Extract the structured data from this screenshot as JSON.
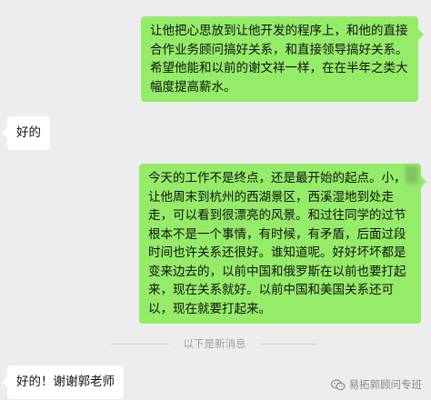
{
  "messages": [
    {
      "side": "out",
      "text": "让他把心思放到让他开发的程序上，和他的直接合作业务顾问搞好关系，和直接领导搞好关系。希望他能和以前的谢文祥一样，在在半年之类大幅度提高薪水。"
    },
    {
      "side": "in",
      "text": "好的"
    },
    {
      "side": "out",
      "text": "今天的工作不是终点，还是最开始的起点。小，让他周末到杭州的西湖景区，西溪湿地到处走走，可以看到很漂亮的风景。和过往同学的过节根本不是一个事情，有时候，有矛盾，后面过段时间也许关系还很好。谁知道呢。好好坏坏都是变来边去的，以前中国和俄罗斯在以前也要打起来，现在关系就好。以前中国和美国关系还可以，现在就要打起来。"
    },
    {
      "side": "in",
      "text": "好的！谢谢郭老师"
    }
  ],
  "divider": {
    "label": "以下是新消息"
  },
  "watermark": {
    "text": "易拓郭顾问专班",
    "icon": "wechat-icon"
  },
  "colors": {
    "background": "#ededed",
    "outgoing": "#95ec69",
    "incoming": "#ffffff"
  }
}
